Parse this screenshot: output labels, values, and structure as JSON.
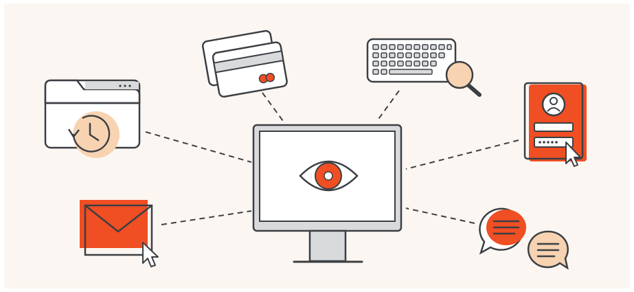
{
  "scene": {
    "subject": "monitoring-illustration",
    "icons": [
      "history-folder-icon",
      "credit-card-icon",
      "keyboard-search-icon",
      "login-form-icon",
      "email-click-icon",
      "chat-bubbles-icon",
      "monitor-eye-icon"
    ]
  },
  "colors": {
    "background": "#fbf6f1",
    "accent": "#f04e23",
    "peach": "#f7d3b2",
    "stroke": "#3b3f44",
    "light_gray": "#d9dadc",
    "white": "#ffffff"
  }
}
